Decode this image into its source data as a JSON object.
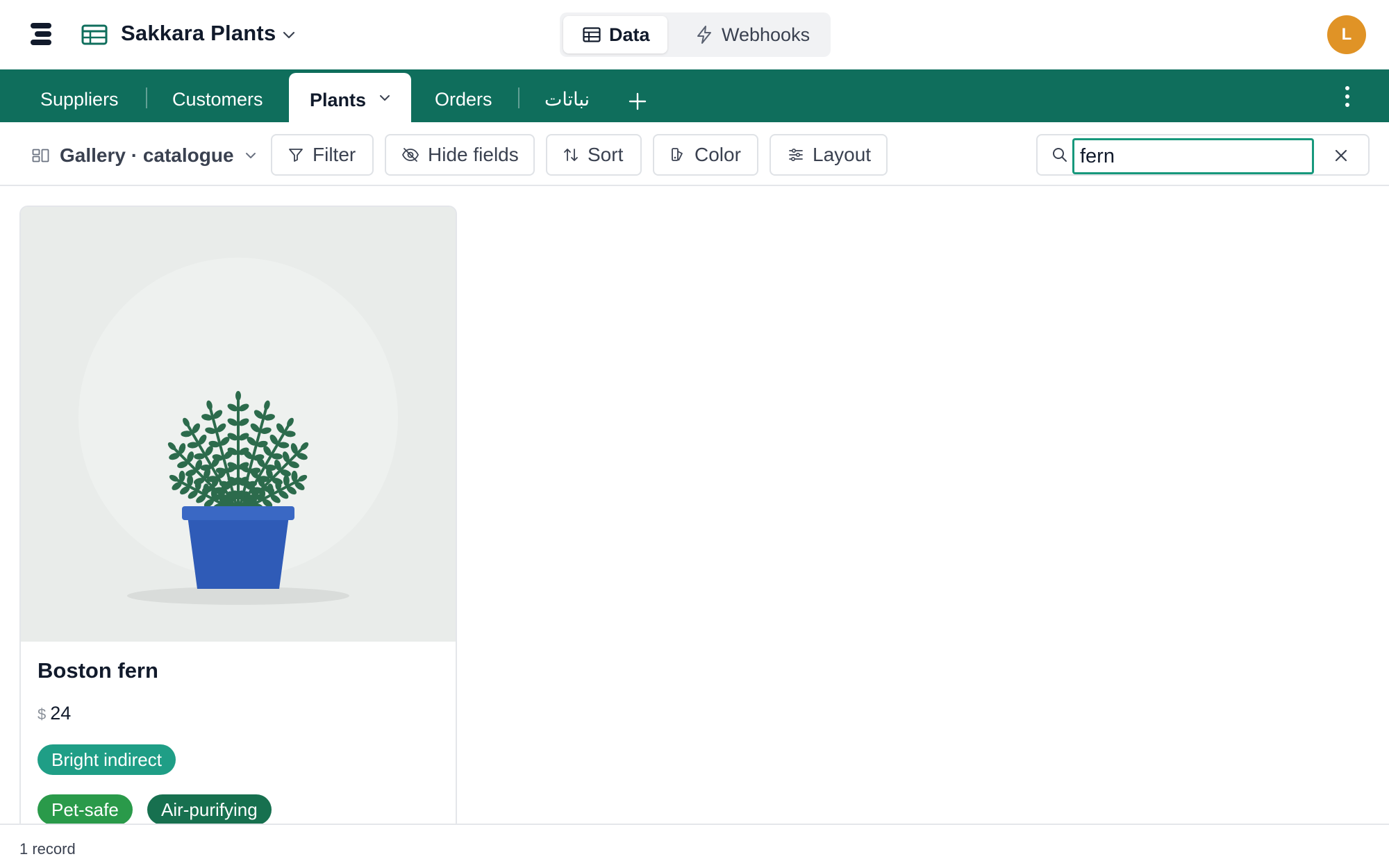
{
  "header": {
    "base_title": "Sakkara Plants",
    "modes": {
      "data": "Data",
      "webhooks": "Webhooks"
    },
    "avatar_initial": "L"
  },
  "tabs": {
    "items": [
      "Suppliers",
      "Customers",
      "Plants",
      "Orders",
      "نباتات"
    ],
    "active": "Plants"
  },
  "toolbar": {
    "view_label": "Gallery · catalogue",
    "filter": "Filter",
    "hide_fields": "Hide fields",
    "sort": "Sort",
    "color": "Color",
    "layout": "Layout"
  },
  "search": {
    "value": "fern"
  },
  "cards": [
    {
      "title": "Boston fern",
      "currency": "$",
      "price": "24",
      "light": "Bright indirect",
      "tags": [
        "Pet-safe",
        "Air-purifying"
      ]
    }
  ],
  "footer": {
    "record_count": "1 record"
  },
  "colors": {
    "brand_green": "#0f6e5c",
    "focus_teal": "#17987c",
    "avatar": "#e09326",
    "tag_light": "#1f9e86",
    "tag_pet_safe": "#2a9a4a",
    "tag_air_purifying": "#17704f",
    "pot_blue": "#2f5bb7",
    "leaf_green": "#2c6b4c"
  }
}
